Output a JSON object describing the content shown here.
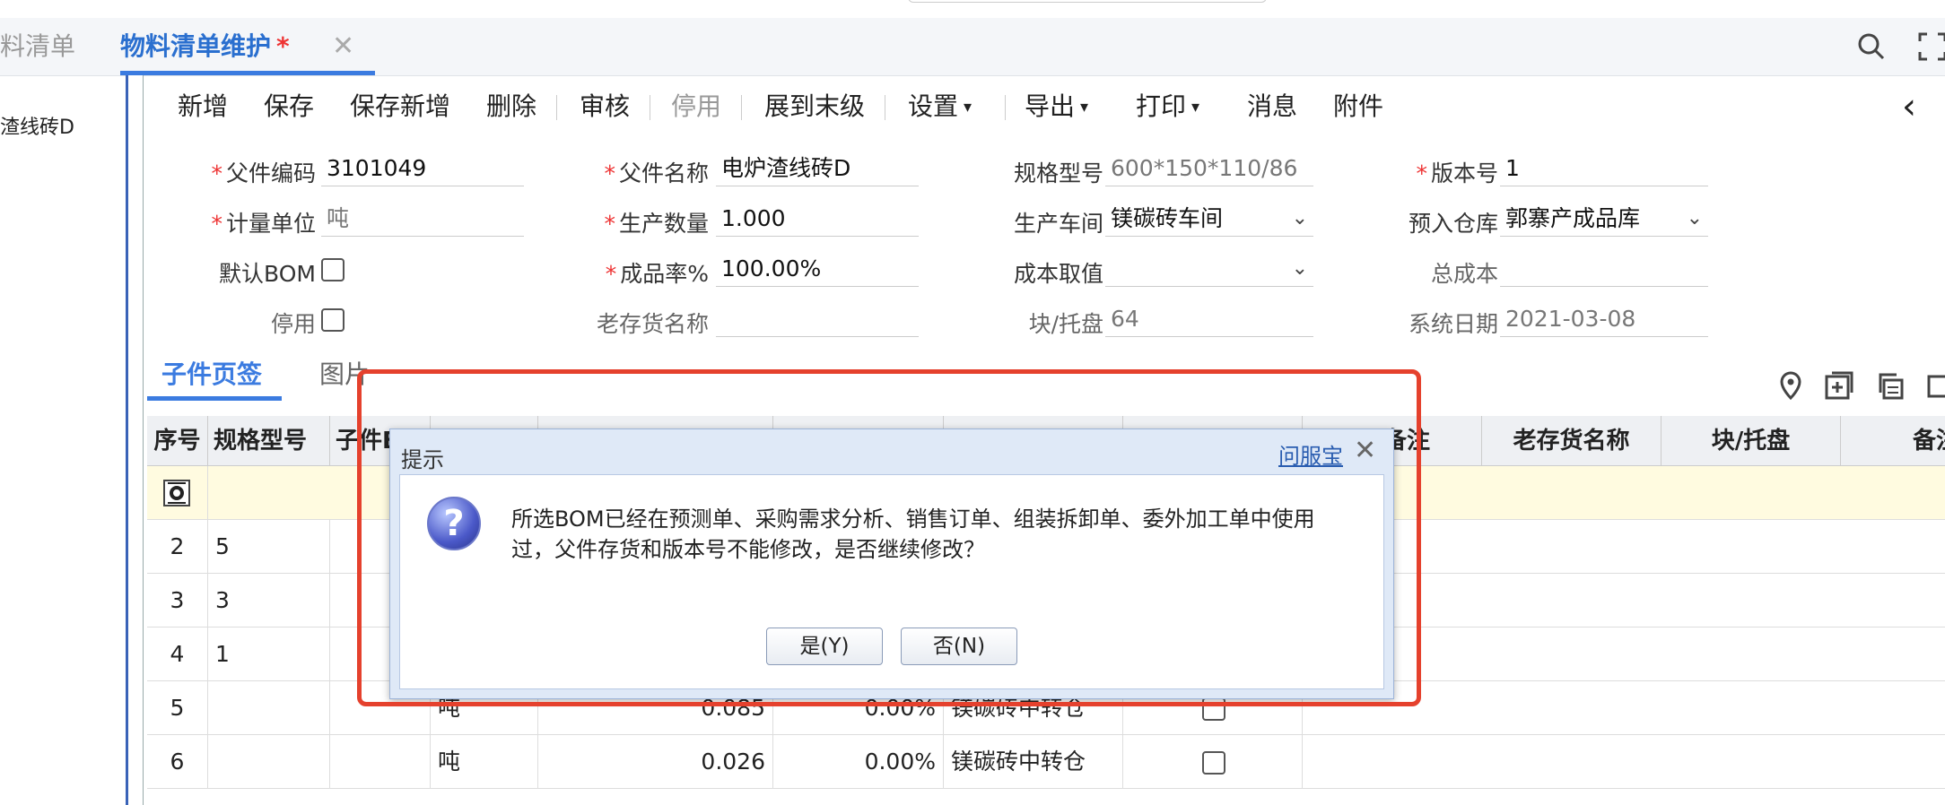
{
  "tabs": {
    "prev_label": "料清单",
    "active_label": "物料清单维护",
    "active_star": "*",
    "close_glyph": "✕"
  },
  "left_panel": {
    "item": "渣线砖D"
  },
  "toolbar": {
    "items": [
      "新增",
      "保存",
      "保存新增",
      "删除",
      "审核",
      "停用",
      "展到末级",
      "设置",
      "导出",
      "打印",
      "消息",
      "附件"
    ]
  },
  "form": {
    "parent_code": {
      "label": "父件编码",
      "value": "3101049"
    },
    "parent_name": {
      "label": "父件名称",
      "value": "电炉渣线砖D"
    },
    "spec": {
      "label": "规格型号",
      "value": "600*150*110/86"
    },
    "version": {
      "label": "版本号",
      "value": "1"
    },
    "unit": {
      "label": "计量单位",
      "value": "吨"
    },
    "quantity": {
      "label": "生产数量",
      "value": "1.000"
    },
    "workshop": {
      "label": "生产车间",
      "value": "镁碳砖车间"
    },
    "warehouse": {
      "label": "预入仓库",
      "value": "郭寨产成品库"
    },
    "default_bom": {
      "label": "默认BOM"
    },
    "yield_rate": {
      "label": "成品率%",
      "value": "100.00%"
    },
    "cost_value": {
      "label": "成本取值",
      "value": ""
    },
    "total_cost": {
      "label": "总成本",
      "value": ""
    },
    "disabled": {
      "label": "停用"
    },
    "old_name": {
      "label": "老存货名称",
      "value": ""
    },
    "per_pallet": {
      "label": "块/托盘",
      "value": "64"
    },
    "sys_date": {
      "label": "系统日期",
      "value": "2021-03-08"
    }
  },
  "subtabs": {
    "first": "子件页签",
    "second": "图片"
  },
  "grid": {
    "headers": [
      "序号",
      "规格型号",
      "子件B",
      "",
      "",
      "",
      "",
      "",
      "备注",
      "老存货名称",
      "块/托盘",
      "备注"
    ],
    "rows": [
      {
        "seq": "2",
        "spec": "5",
        "unit": "",
        "qty": "",
        "rate": "",
        "wh": ""
      },
      {
        "seq": "3",
        "spec": "3",
        "unit": "",
        "qty": "",
        "rate": "",
        "wh": ""
      },
      {
        "seq": "4",
        "spec": "1",
        "unit": "",
        "qty": "",
        "rate": "",
        "wh": ""
      },
      {
        "seq": "5",
        "spec": "",
        "unit": "吨",
        "qty": "0.085",
        "rate": "0.00%",
        "wh": "镁碳砖中转仓"
      },
      {
        "seq": "6",
        "spec": "",
        "unit": "吨",
        "qty": "0.026",
        "rate": "0.00%",
        "wh": "镁碳砖中转仓"
      }
    ]
  },
  "dialog": {
    "title": "提示",
    "link": "问服宝",
    "close": "✕",
    "message": "所选BOM已经在预测单、采购需求分析、销售订单、组装拆卸单、委外加工单中使用过，父件存货和版本号不能修改，是否继续修改？",
    "yes_label": "是(Y)",
    "no_label": "否(N)"
  }
}
